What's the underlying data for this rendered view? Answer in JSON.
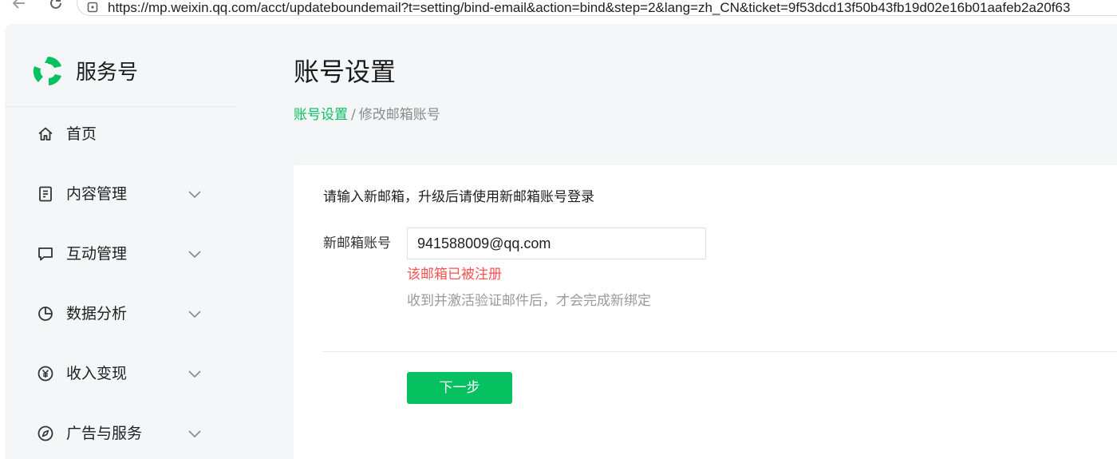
{
  "browser": {
    "url": "https://mp.weixin.qq.com/acct/updateboundemail?t=setting/bind-email&action=bind&step=2&lang=zh_CN&ticket=9f53dcd13f50b43fb19d02e16b01aafeb2a20f63"
  },
  "brand": {
    "name": "服务号",
    "accent_color": "#07c160"
  },
  "sidebar": {
    "items": [
      {
        "label": "首页",
        "icon": "home-icon",
        "expandable": false
      },
      {
        "label": "内容管理",
        "icon": "document-icon",
        "expandable": true
      },
      {
        "label": "互动管理",
        "icon": "chat-bubble-icon",
        "expandable": true
      },
      {
        "label": "数据分析",
        "icon": "pie-chart-icon",
        "expandable": true
      },
      {
        "label": "收入变现",
        "icon": "yuan-coin-icon",
        "expandable": true
      },
      {
        "label": "广告与服务",
        "icon": "compass-icon",
        "expandable": true
      }
    ]
  },
  "main": {
    "title": "账号设置",
    "breadcrumb": {
      "parent": "账号设置",
      "separator": "/",
      "current": "修改邮箱账号"
    },
    "form": {
      "intro": "请输入新邮箱，升级后请使用新邮箱账号登录",
      "field_label": "新邮箱账号",
      "field_value": "941588009@qq.com",
      "error": "该邮箱已被注册",
      "tip": "收到并激活验证邮件后，才会完成新绑定",
      "next_button": "下一步"
    }
  },
  "colors": {
    "primary": "#07c160",
    "error": "#fa5151",
    "sidebar_bg": "#f5f6f7"
  }
}
